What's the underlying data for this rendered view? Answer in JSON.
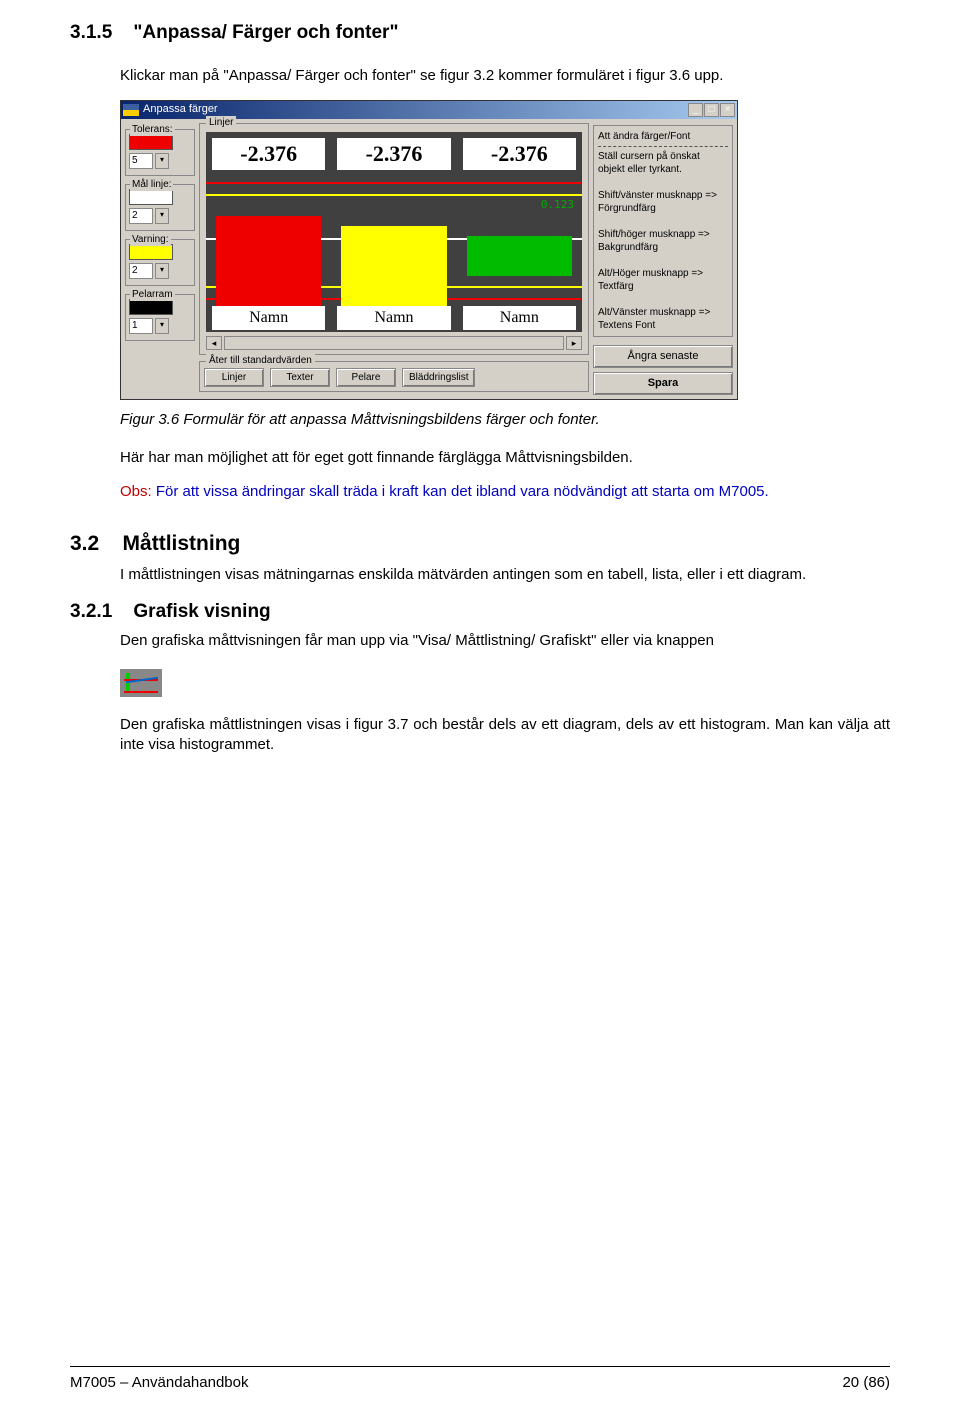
{
  "section315": {
    "num": "3.1.5",
    "title": "\"Anpassa/ Färger och fonter\"",
    "intro": "Klickar man på \"Anpassa/ Färger och fonter\" se figur 3.2 kommer formuläret i figur 3.6 upp.",
    "figcap": "Figur 3.6 Formulär för att anpassa Måttvisningsbildens färger och fonter.",
    "p2": "Här har man möjlighet att för eget gott finnande färglägga Måttvisningsbilden.",
    "obs_label": "Obs:",
    "obs_text": " För att vissa ändringar skall träda i kraft kan det ibland vara nödvändigt att starta om M7005."
  },
  "win": {
    "title": "Anpassa färger",
    "btn_min": "_",
    "btn_max": "□",
    "btn_close": "×",
    "group_linjer": "Linjer",
    "tolerans": "Tolerans:",
    "tol_val": "5",
    "mal": "Mål linje:",
    "mal_val": "2",
    "varning": "Varning:",
    "varn_val": "2",
    "pelarram": "Pelarram",
    "pel_val": "1",
    "bigvals": [
      "-2.376",
      "-2.376",
      "-2.376"
    ],
    "namn": [
      "Namn",
      "Namn",
      "Namn"
    ],
    "smallnum": "0.123",
    "scroll_left": "◂",
    "scroll_right": "▸",
    "reset_title": "Åter till standardvärden",
    "reset_btns": [
      "Linjer",
      "Texter",
      "Pelare",
      "Bläddringslist"
    ],
    "instr_title": "Att ändra färger/Font",
    "instr1": "Ställ cursern på önskat objekt eller tyrkant.",
    "instr2a": "Shift/vänster musknapp =>",
    "instr2b": "Förgrundfärg",
    "instr3a": "Shift/höger  musknapp =>",
    "instr3b": "Bakgrundfärg",
    "instr4a": "Alt/Höger musknapp =>",
    "instr4b": "Textfärg",
    "instr5a": "Alt/Vänster musknapp =>",
    "instr5b": "Textens Font",
    "btn_undo": "Ångra senaste",
    "btn_save": "Spara"
  },
  "section32": {
    "num": "3.2",
    "title": "Måttlistning",
    "body": "I måttlistningen visas mätningarnas enskilda mätvärden antingen som en tabell, lista, eller  i ett diagram."
  },
  "section321": {
    "num": "3.2.1",
    "title": "Grafisk visning",
    "body1": "Den grafiska måttvisningen får man upp via \"Visa/ Måttlistning/ Grafiskt\" eller via knappen",
    "body2": "Den grafiska måttlistningen visas i figur 3.7 och består dels av ett diagram, dels av ett histogram. Man kan välja att inte visa histogrammet."
  },
  "footer": {
    "left": "M7005 – Användahandbok",
    "right": "20 (86)"
  }
}
